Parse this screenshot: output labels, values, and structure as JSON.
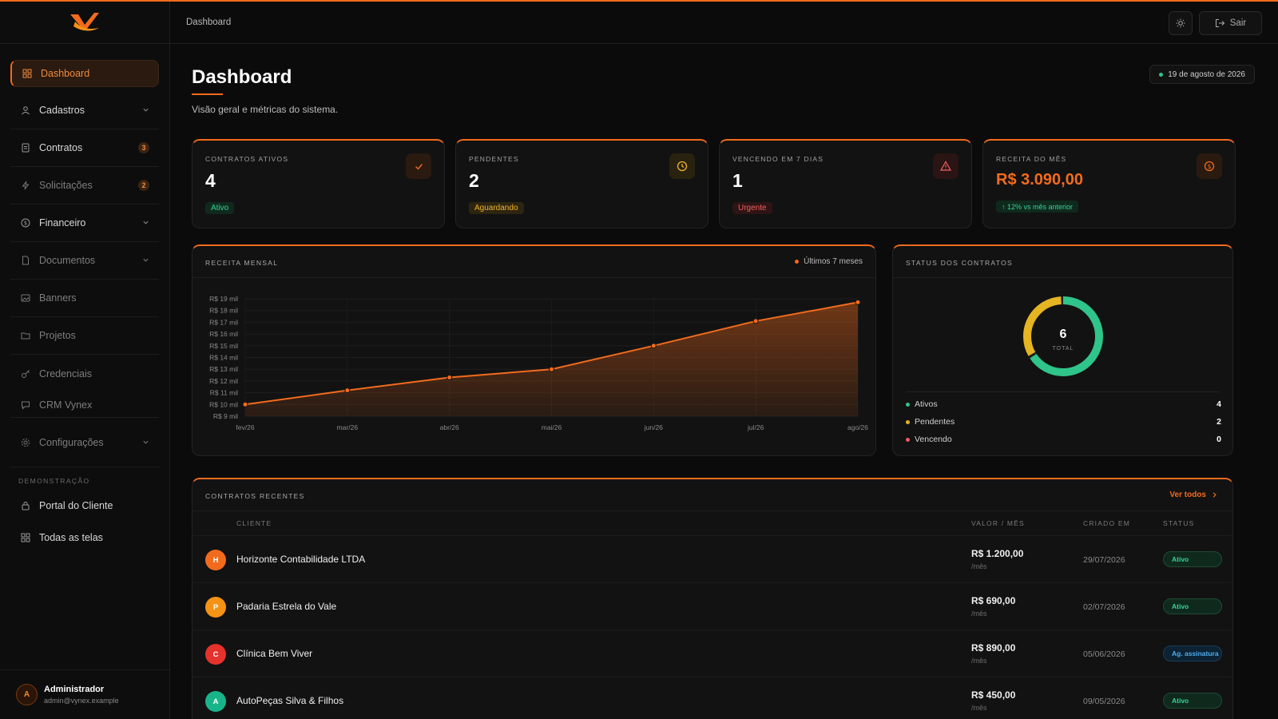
{
  "brand": {
    "accent": "#f26b1d"
  },
  "topbar": {
    "breadcrumb": "Dashboard",
    "theme_icon": "sun-icon",
    "logout_label": "Sair"
  },
  "sidebar": {
    "items": [
      {
        "label": "Dashboard",
        "icon": "grid-icon"
      },
      {
        "label": "Cadastros",
        "icon": "users-icon"
      },
      {
        "label": "Contratos",
        "icon": "file-icon",
        "badge": "3"
      },
      {
        "label": "Solicitações",
        "icon": "bolt-icon",
        "badge": "2"
      },
      {
        "label": "Financeiro",
        "icon": "dollar-icon"
      },
      {
        "label": "Documentos",
        "icon": "document-icon"
      },
      {
        "label": "Banners",
        "icon": "image-icon"
      },
      {
        "label": "Projetos",
        "icon": "folder-icon"
      },
      {
        "label": "Credenciais",
        "icon": "key-icon"
      },
      {
        "label": "CRM Vynex",
        "icon": "chat-icon"
      },
      {
        "label": "Configurações",
        "icon": "gear-icon"
      }
    ],
    "section_label": "DEMONSTRAÇÃO",
    "demo_items": [
      {
        "label": "Portal do Cliente",
        "icon": "lock-icon"
      },
      {
        "label": "Todas as telas",
        "icon": "grid-icon"
      }
    ],
    "user": {
      "initial": "A",
      "name": "Administrador",
      "email": "admin@vynex.example"
    }
  },
  "header": {
    "title": "Dashboard",
    "subtitle": "Visão geral e métricas do sistema.",
    "date": "19 de agosto de 2026"
  },
  "kpis": [
    {
      "label": "CONTRATOS ATIVOS",
      "value": "4",
      "pill": "Ativo",
      "icon": "check-icon"
    },
    {
      "label": "PENDENTES",
      "value": "2",
      "pill": "Aguardando",
      "icon": "clock-icon"
    },
    {
      "label": "VENCENDO EM 7 DIAS",
      "value": "1",
      "pill": "Urgente",
      "icon": "alert-icon"
    },
    {
      "label": "RECEITA DO MÊS",
      "value": "R$ 3.090,00",
      "pill": "↑ 12% vs mês anterior",
      "icon": "dollar-circle-icon"
    }
  ],
  "revenue_panel": {
    "title": "RECEITA MENSAL",
    "period": "Últimos 7 meses"
  },
  "chart_data": {
    "type": "area",
    "x": [
      "fev/26",
      "mar/26",
      "abr/26",
      "mai/26",
      "jun/26",
      "jul/26",
      "ago/26"
    ],
    "series": [
      {
        "values": [
          10000,
          11200,
          12300,
          13000,
          15000,
          17100,
          18700
        ]
      }
    ],
    "yticks": [
      "R$ 9 mil",
      "R$ 10 mil",
      "R$ 11 mil",
      "R$ 12 mil",
      "R$ 13 mil",
      "R$ 14 mil",
      "R$ 15 mil",
      "R$ 16 mil",
      "R$ 17 mil",
      "R$ 18 mil",
      "R$ 19 mil"
    ],
    "ylim": [
      9000,
      19000
    ],
    "color": "#f26b1d",
    "grid": true
  },
  "status_panel": {
    "title": "STATUS DOS CONTRATOS",
    "total": "6",
    "total_label": "TOTAL",
    "legend": [
      {
        "label": "Ativos",
        "value": "4",
        "color": "#2fc48a"
      },
      {
        "label": "Pendentes",
        "value": "2",
        "color": "#e5b422"
      },
      {
        "label": "Vencendo",
        "value": "0",
        "color": "#ef5a5a"
      }
    ]
  },
  "recent": {
    "title": "CONTRATOS RECENTES",
    "see_all": "Ver todos",
    "columns": [
      "CLIENTE",
      "VALOR / MÊS",
      "CRIADO EM",
      "STATUS"
    ],
    "rows": [
      {
        "initial": "H",
        "client": "Horizonte Contabilidade LTDA",
        "value": "R$ 1.200,00",
        "period": "/mês",
        "date": "29/07/2026",
        "status": "Ativo",
        "color": "#f26b1d"
      },
      {
        "initial": "P",
        "client": "Padaria Estrela do Vale",
        "value": "R$ 690,00",
        "period": "/mês",
        "date": "02/07/2026",
        "status": "Ativo",
        "color": "#f59316"
      },
      {
        "initial": "C",
        "client": "Clínica Bem Viver",
        "value": "R$ 890,00",
        "period": "/mês",
        "date": "05/06/2026",
        "status": "Ag. assinatura",
        "color": "#e5322d"
      },
      {
        "initial": "A",
        "client": "AutoPeças Silva & Filhos",
        "value": "R$ 450,00",
        "period": "/mês",
        "date": "09/05/2026",
        "status": "Ativo",
        "color": "#19b58a"
      }
    ]
  }
}
